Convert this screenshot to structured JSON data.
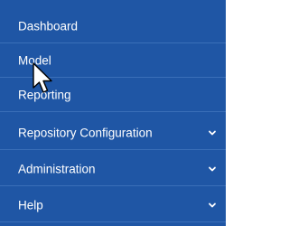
{
  "sidebar": {
    "items": [
      {
        "label": "Dashboard",
        "icon": null
      },
      {
        "label": "Model",
        "icon": null
      },
      {
        "label": "Reporting",
        "icon": null
      },
      {
        "label": "Repository Configuration",
        "icon": "chevron-down-icon"
      },
      {
        "label": "Administration",
        "icon": "chevron-down-icon"
      },
      {
        "label": "Help",
        "icon": "chevron-down-icon"
      }
    ]
  },
  "colors": {
    "sidebar_bg": "#1f56a5",
    "divider": "#3a6fb8",
    "text": "#ffffff"
  },
  "cursor": {
    "icon": "mouse-pointer-icon"
  }
}
